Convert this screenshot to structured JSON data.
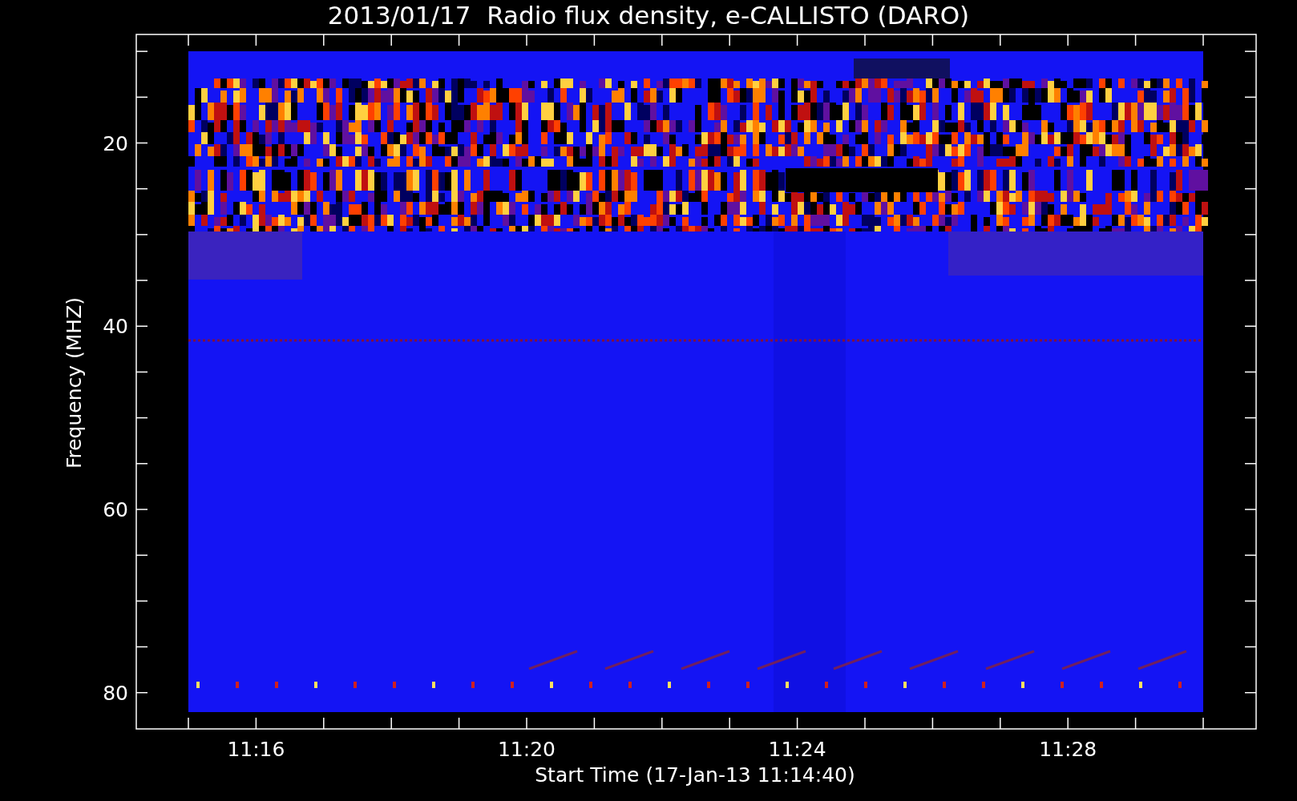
{
  "plot": {
    "title": "2013/01/17  Radio flux density, e-CALLISTO (DARO)",
    "xlabel": "Start Time (17-Jan-13 11:14:40)",
    "ylabel": "Frequency (MHZ)",
    "y_tick_labels": [
      "20",
      "40",
      "60",
      "80"
    ],
    "x_tick_labels": [
      "11:16",
      "11:20",
      "11:24",
      "11:28"
    ]
  }
}
